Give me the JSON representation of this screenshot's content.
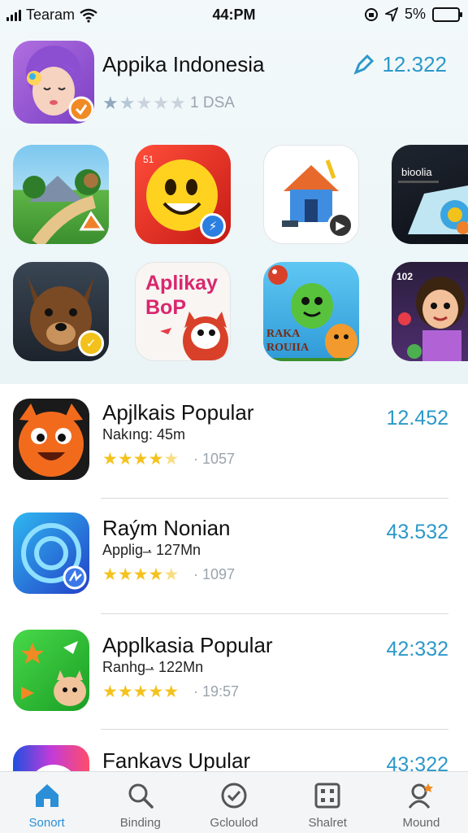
{
  "status_bar": {
    "carrier": "Tearam",
    "time": "44:PM",
    "battery": "5%"
  },
  "featured": {
    "title": "Appika Indonesia",
    "rating_count": "1 DSA",
    "price": "12.322",
    "rating_stars": 1.5
  },
  "grid": {
    "row1": [
      {
        "name": "landscape-game-app"
      },
      {
        "name": "smiley-app",
        "label": "51"
      },
      {
        "name": "doghouse-app"
      },
      {
        "name": "tech-app",
        "label": "bioolia"
      }
    ],
    "row2": [
      {
        "name": "dog-app"
      },
      {
        "name": "aplikay-bop-app",
        "label": "Aplikay BoP"
      },
      {
        "name": "raka-rouiia-app",
        "label": "RAKA ROUIIA"
      },
      {
        "name": "kid-app",
        "label": "102"
      }
    ]
  },
  "list": [
    {
      "title": "Apjlkais Popular",
      "subtitle": "Nakıng: 45m",
      "rating_count": "· 1057",
      "price": "12.452",
      "rating_stars": 4.5,
      "accent": "#f26b1d"
    },
    {
      "title": "Raým Nonian",
      "subtitle": "Applig ̶· 127Mn",
      "rating_count": "· 1097",
      "price": "43.532",
      "rating_stars": 4.5,
      "accent": "#2b6fe0"
    },
    {
      "title": "Applkasia Popular",
      "subtitle": "Ranhg ̶· 122Mn",
      "rating_count": "· 19:57",
      "price": "42:332",
      "rating_stars": 5,
      "accent": "#2fc43b"
    },
    {
      "title": "Fankavs Upular",
      "subtitle": "",
      "rating_count": "",
      "price": "43:322",
      "rating_stars": 0,
      "accent": "#c23bd9"
    }
  ],
  "tabs": [
    {
      "label": "Sonort",
      "icon": "home-icon",
      "active": true
    },
    {
      "label": "Binding",
      "icon": "search-icon",
      "active": false
    },
    {
      "label": "Gcloulod",
      "icon": "check-circle-icon",
      "active": false
    },
    {
      "label": "Shalret",
      "icon": "grid-icon",
      "active": false
    },
    {
      "label": "Mound",
      "icon": "profile-icon",
      "active": false
    }
  ],
  "colors": {
    "accent_blue": "#2d98c9",
    "star_yellow": "#f4c21d",
    "tab_active": "#2a8fd6"
  }
}
